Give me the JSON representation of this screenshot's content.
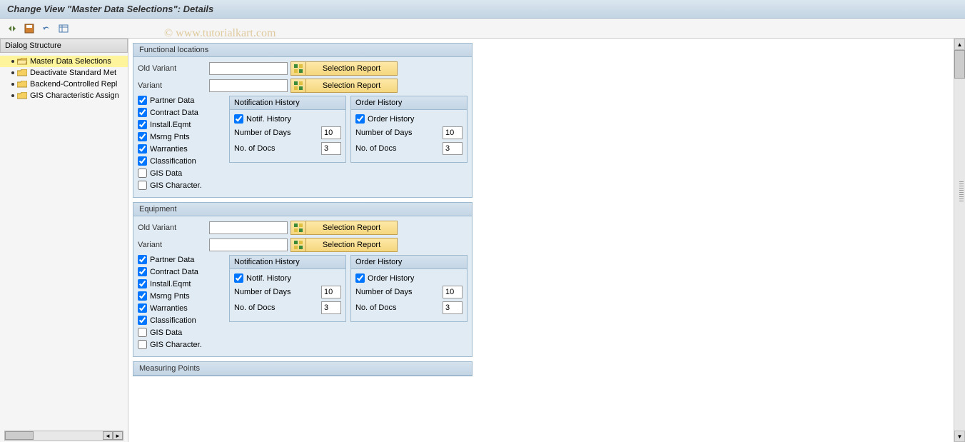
{
  "title": "Change View \"Master Data Selections\": Details",
  "watermark": "© www.tutorialkart.com",
  "sidebar": {
    "header": "Dialog Structure",
    "items": [
      {
        "label": "Master Data Selections",
        "selected": true,
        "open": true
      },
      {
        "label": "Deactivate Standard Met",
        "selected": false,
        "open": false
      },
      {
        "label": "Backend-Controlled Repl",
        "selected": false,
        "open": false
      },
      {
        "label": "GIS Characteristic Assign",
        "selected": false,
        "open": false
      }
    ]
  },
  "buttons": {
    "selection_report": "Selection Report"
  },
  "labels": {
    "old_variant": "Old Variant",
    "variant": "Variant",
    "partner_data": "Partner Data",
    "contract_data": "Contract Data",
    "install_eqmt": "Install.Eqmt",
    "msrng_pnts": "Msrng Pnts",
    "warranties": "Warranties",
    "classification": "Classification",
    "gis_data": "GIS Data",
    "gis_character": "GIS Character.",
    "notif_history_title": "Notification History",
    "notif_history_cb": "Notif. History",
    "order_history_title": "Order History",
    "order_history_cb": "Order History",
    "num_days": "Number of Days",
    "num_docs": "No. of Docs"
  },
  "sections": {
    "funcloc": {
      "title": "Functional locations",
      "old_variant": "",
      "variant": "",
      "partner_data": true,
      "contract_data": true,
      "install_eqmt": true,
      "msrng_pnts": true,
      "warranties": true,
      "classification": true,
      "gis_data": false,
      "gis_character": false,
      "notif": {
        "checked": true,
        "days": "10",
        "docs": "3"
      },
      "order": {
        "checked": true,
        "days": "10",
        "docs": "3"
      }
    },
    "equipment": {
      "title": "Equipment",
      "old_variant": "",
      "variant": "",
      "partner_data": true,
      "contract_data": true,
      "install_eqmt": true,
      "msrng_pnts": true,
      "warranties": true,
      "classification": true,
      "gis_data": false,
      "gis_character": false,
      "notif": {
        "checked": true,
        "days": "10",
        "docs": "3"
      },
      "order": {
        "checked": true,
        "days": "10",
        "docs": "3"
      }
    },
    "measuring": {
      "title": "Measuring Points"
    }
  }
}
